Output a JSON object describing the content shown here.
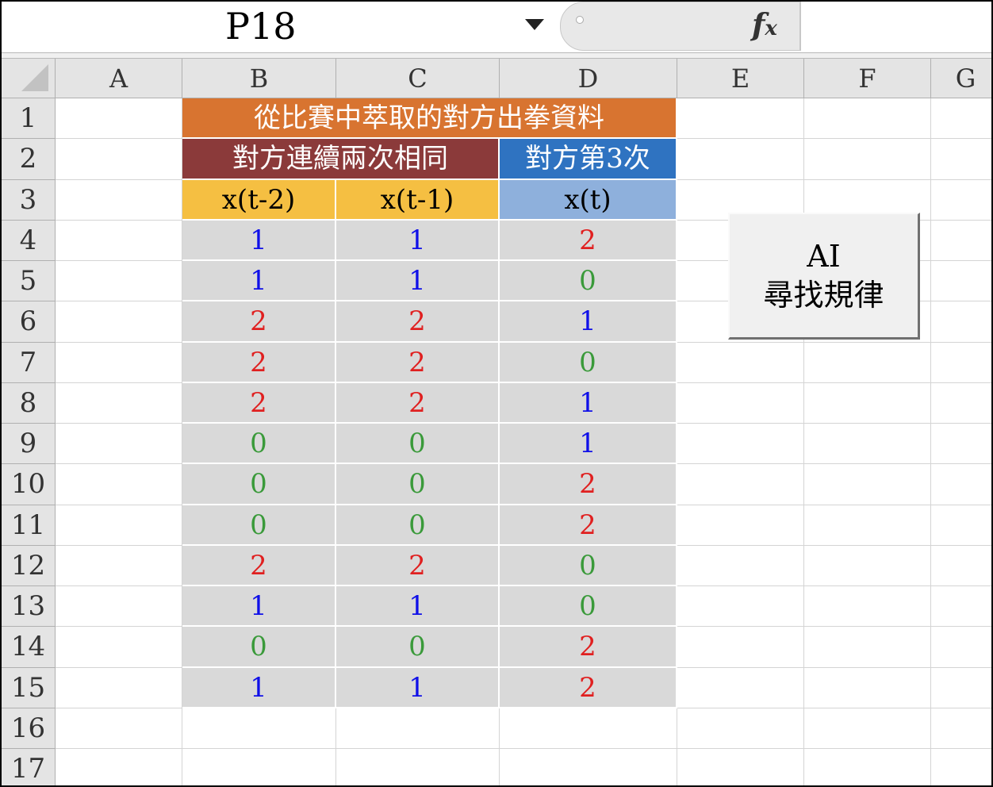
{
  "formula_bar": {
    "name_box": "P18",
    "fx_label": "fx"
  },
  "columns": [
    "A",
    "B",
    "C",
    "D",
    "E",
    "F",
    "G"
  ],
  "rows": [
    "1",
    "2",
    "3",
    "4",
    "5",
    "6",
    "7",
    "8",
    "9",
    "10",
    "11",
    "12",
    "13",
    "14",
    "15",
    "16",
    "17"
  ],
  "sheet": {
    "title": "從比賽中萃取的對方出拳資料",
    "subheader_left": "對方連續兩次相同",
    "subheader_right": "對方第3次",
    "col_headers": [
      "x(t-2)",
      "x(t-1)",
      "x(t)"
    ],
    "data_rows": [
      [
        "1",
        "1",
        "2"
      ],
      [
        "1",
        "1",
        "0"
      ],
      [
        "2",
        "2",
        "1"
      ],
      [
        "2",
        "2",
        "0"
      ],
      [
        "2",
        "2",
        "1"
      ],
      [
        "0",
        "0",
        "1"
      ],
      [
        "0",
        "0",
        "2"
      ],
      [
        "0",
        "0",
        "2"
      ],
      [
        "2",
        "2",
        "0"
      ],
      [
        "1",
        "1",
        "0"
      ],
      [
        "0",
        "0",
        "2"
      ],
      [
        "1",
        "1",
        "2"
      ]
    ]
  },
  "colors": {
    "title_bg": "#d87430",
    "subheader_left_bg": "#8b3a3a",
    "subheader_right_bg": "#2f73c1",
    "col_header_left_bg": "#f5bf42",
    "col_header_right_bg": "#8eb0dc",
    "data_bg": "#d9d9d9",
    "value_0": "#3a9a3a",
    "value_1": "#1010e8",
    "value_2": "#e02020"
  },
  "button": {
    "line1": "AI",
    "line2": "尋找規律"
  }
}
